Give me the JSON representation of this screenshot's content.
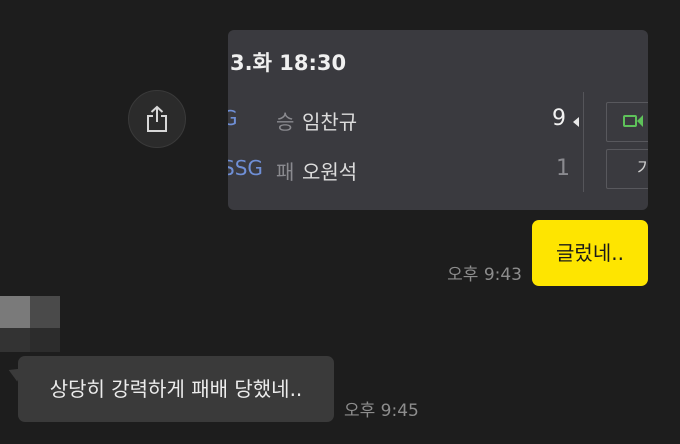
{
  "game_card": {
    "datetime": "3.화  18:30",
    "rows": [
      {
        "team": "LG",
        "team_visible": "G",
        "result": "승",
        "pitcher": "임찬규",
        "score": "9",
        "winner": true
      },
      {
        "team": "SSG",
        "team_visible": "SSG",
        "result": "패",
        "pitcher": "오원석",
        "score": "1",
        "winner": false
      }
    ],
    "record_button_label": "기",
    "highlight_icon": "video-icon"
  },
  "share_button": {
    "icon": "share-icon"
  },
  "messages": [
    {
      "from": "me",
      "text": "글렀네..",
      "time": "오후 9:43"
    },
    {
      "from": "them",
      "text": "상당히 강력하게 패배 당했네..",
      "time": "오후 9:45"
    }
  ],
  "colors": {
    "background": "#1d1d1d",
    "my_bubble": "#fee500",
    "their_bubble": "#3a3a3a",
    "team_label": "#6f8fd6",
    "highlight_icon": "#5ec25a"
  }
}
